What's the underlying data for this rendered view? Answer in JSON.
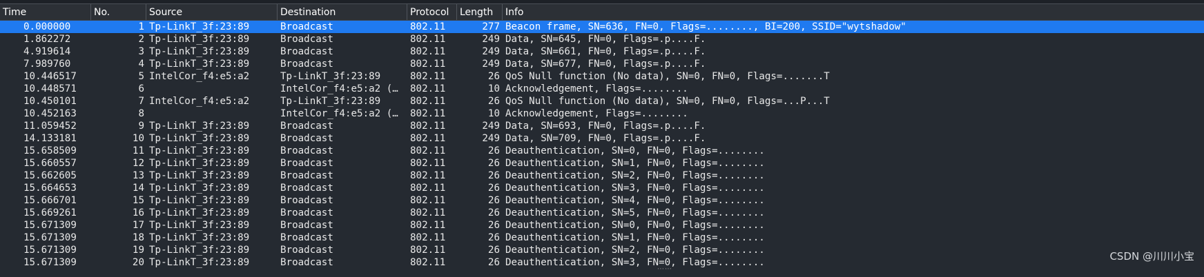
{
  "columns": {
    "time": "Time",
    "no": "No.",
    "source": "Source",
    "destination": "Destination",
    "protocol": "Protocol",
    "length": "Length",
    "info": "Info"
  },
  "packets": [
    {
      "time": "0.000000",
      "no": "1",
      "source": "Tp-LinkT_3f:23:89",
      "destination": "Broadcast",
      "protocol": "802.11",
      "length": "277",
      "info": "Beacon frame, SN=636, FN=0, Flags=........, BI=200, SSID=\"wytshadow\""
    },
    {
      "time": "1.862272",
      "no": "2",
      "source": "Tp-LinkT_3f:23:89",
      "destination": "Broadcast",
      "protocol": "802.11",
      "length": "249",
      "info": "Data, SN=645, FN=0, Flags=.p....F."
    },
    {
      "time": "4.919614",
      "no": "3",
      "source": "Tp-LinkT_3f:23:89",
      "destination": "Broadcast",
      "protocol": "802.11",
      "length": "249",
      "info": "Data, SN=661, FN=0, Flags=.p....F."
    },
    {
      "time": "7.989760",
      "no": "4",
      "source": "Tp-LinkT_3f:23:89",
      "destination": "Broadcast",
      "protocol": "802.11",
      "length": "249",
      "info": "Data, SN=677, FN=0, Flags=.p....F."
    },
    {
      "time": "10.446517",
      "no": "5",
      "source": "IntelCor_f4:e5:a2",
      "destination": "Tp-LinkT_3f:23:89",
      "protocol": "802.11",
      "length": "26",
      "info": "QoS Null function (No data), SN=0, FN=0, Flags=.......T"
    },
    {
      "time": "10.448571",
      "no": "6",
      "source": "",
      "destination": "IntelCor_f4:e5:a2 (…",
      "protocol": "802.11",
      "length": "10",
      "info": "Acknowledgement, Flags=........"
    },
    {
      "time": "10.450101",
      "no": "7",
      "source": "IntelCor_f4:e5:a2",
      "destination": "Tp-LinkT_3f:23:89",
      "protocol": "802.11",
      "length": "26",
      "info": "QoS Null function (No data), SN=0, FN=0, Flags=...P...T"
    },
    {
      "time": "10.452163",
      "no": "8",
      "source": "",
      "destination": "IntelCor_f4:e5:a2 (…",
      "protocol": "802.11",
      "length": "10",
      "info": "Acknowledgement, Flags=........"
    },
    {
      "time": "11.059452",
      "no": "9",
      "source": "Tp-LinkT_3f:23:89",
      "destination": "Broadcast",
      "protocol": "802.11",
      "length": "249",
      "info": "Data, SN=693, FN=0, Flags=.p....F."
    },
    {
      "time": "14.133181",
      "no": "10",
      "source": "Tp-LinkT_3f:23:89",
      "destination": "Broadcast",
      "protocol": "802.11",
      "length": "249",
      "info": "Data, SN=709, FN=0, Flags=.p....F."
    },
    {
      "time": "15.658509",
      "no": "11",
      "source": "Tp-LinkT_3f:23:89",
      "destination": "Broadcast",
      "protocol": "802.11",
      "length": "26",
      "info": "Deauthentication, SN=0, FN=0, Flags=........"
    },
    {
      "time": "15.660557",
      "no": "12",
      "source": "Tp-LinkT_3f:23:89",
      "destination": "Broadcast",
      "protocol": "802.11",
      "length": "26",
      "info": "Deauthentication, SN=1, FN=0, Flags=........"
    },
    {
      "time": "15.662605",
      "no": "13",
      "source": "Tp-LinkT_3f:23:89",
      "destination": "Broadcast",
      "protocol": "802.11",
      "length": "26",
      "info": "Deauthentication, SN=2, FN=0, Flags=........"
    },
    {
      "time": "15.664653",
      "no": "14",
      "source": "Tp-LinkT_3f:23:89",
      "destination": "Broadcast",
      "protocol": "802.11",
      "length": "26",
      "info": "Deauthentication, SN=3, FN=0, Flags=........"
    },
    {
      "time": "15.666701",
      "no": "15",
      "source": "Tp-LinkT_3f:23:89",
      "destination": "Broadcast",
      "protocol": "802.11",
      "length": "26",
      "info": "Deauthentication, SN=4, FN=0, Flags=........"
    },
    {
      "time": "15.669261",
      "no": "16",
      "source": "Tp-LinkT_3f:23:89",
      "destination": "Broadcast",
      "protocol": "802.11",
      "length": "26",
      "info": "Deauthentication, SN=5, FN=0, Flags=........"
    },
    {
      "time": "15.671309",
      "no": "17",
      "source": "Tp-LinkT_3f:23:89",
      "destination": "Broadcast",
      "protocol": "802.11",
      "length": "26",
      "info": "Deauthentication, SN=0, FN=0, Flags=........"
    },
    {
      "time": "15.671309",
      "no": "18",
      "source": "Tp-LinkT_3f:23:89",
      "destination": "Broadcast",
      "protocol": "802.11",
      "length": "26",
      "info": "Deauthentication, SN=1, FN=0, Flags=........"
    },
    {
      "time": "15.671309",
      "no": "19",
      "source": "Tp-LinkT_3f:23:89",
      "destination": "Broadcast",
      "protocol": "802.11",
      "length": "26",
      "info": "Deauthentication, SN=2, FN=0, Flags=........"
    },
    {
      "time": "15.671309",
      "no": "20",
      "source": "Tp-LinkT_3f:23:89",
      "destination": "Broadcast",
      "protocol": "802.11",
      "length": "26",
      "info": "Deauthentication, SN=3, FN=0, Flags=........"
    }
  ],
  "selected_index": 0,
  "watermark": "CSDN @川川小宝",
  "colors": {
    "selection": "#1f7af0",
    "background": "#252a31"
  }
}
